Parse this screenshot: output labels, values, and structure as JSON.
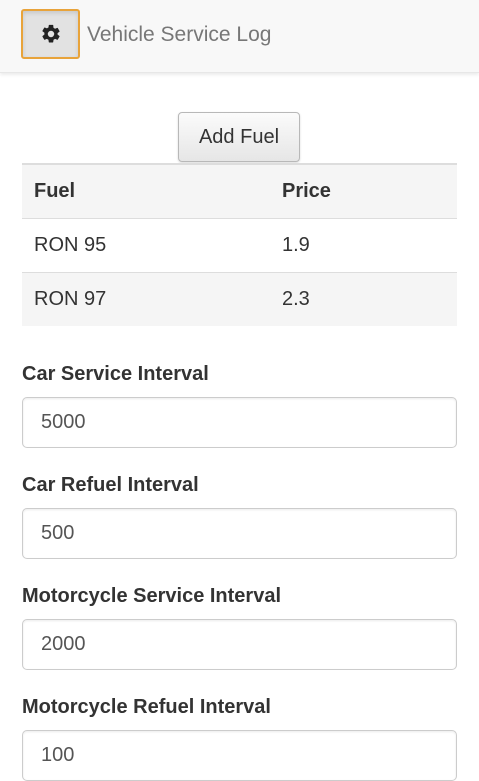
{
  "header": {
    "title": "Vehicle Service Log",
    "settings_icon": "gear-icon"
  },
  "fuel": {
    "add_button_label": "Add Fuel",
    "columns": [
      "Fuel",
      "Price"
    ],
    "rows": [
      [
        "RON 95",
        "1.9"
      ],
      [
        "RON 97",
        "2.3"
      ]
    ]
  },
  "settings": {
    "car_service": {
      "label": "Car Service Interval",
      "value": "5000"
    },
    "car_refuel": {
      "label": "Car Refuel Interval",
      "value": "500"
    },
    "moto_service": {
      "label": "Motorcycle Service Interval",
      "value": "2000"
    },
    "moto_refuel": {
      "label": "Motorcycle Refuel Interval",
      "value": "100"
    }
  },
  "colors": {
    "accent_border": "#e8a33a",
    "navbar_bg": "#f8f8f8"
  }
}
